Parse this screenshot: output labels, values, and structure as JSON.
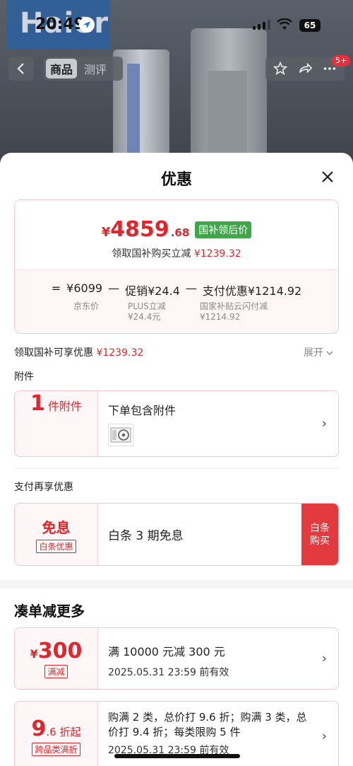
{
  "status": {
    "time": "20:49",
    "battery": "65"
  },
  "background": {
    "brand_logo": "Haier"
  },
  "nav": {
    "tabs": [
      {
        "label": "商品"
      },
      {
        "label": "测评"
      }
    ],
    "badge": "5+"
  },
  "sheet": {
    "title": "优惠",
    "price": {
      "yen": "¥",
      "integer": "4859",
      "decimal": ".68",
      "tag": "国补领后价",
      "subtitle_prefix": "领取国补购买立减",
      "subtitle_amount": "¥1239.32"
    },
    "formula": {
      "eq": "=",
      "base": "¥6099",
      "minus1": "—",
      "promo": "促销¥24.4",
      "minus2": "—",
      "pay": "支付优惠¥1214.92",
      "base_label": "京东价",
      "promo_label1": "PLUS立减",
      "promo_label2": "¥24.4元",
      "pay_label1": "国家补贴云闪付减",
      "pay_label2": "¥1214.92"
    },
    "subsidy_row": {
      "label": "领取国补可享优惠",
      "amount": "¥1239.32",
      "expand": "展开"
    },
    "accessory": {
      "section": "附件",
      "count": "1",
      "count_unit": "件附件",
      "desc": "下单包含附件"
    },
    "pay_discount": {
      "section": "支付再享优惠",
      "title": "免息",
      "tag": "白条优惠",
      "desc": "白条 3 期免息",
      "button_line1": "白条",
      "button_line2": "购买"
    },
    "more": {
      "section": "凑单减更多",
      "coupons": [
        {
          "yen": "¥",
          "value": "300",
          "suffix": "",
          "tag": "满减",
          "title": "满 10000 元减 300 元",
          "valid": "2025.05.31 23:59 前有效"
        },
        {
          "yen": "",
          "value": "9",
          "suffix": ".6 折起",
          "tag": "跨品类满折",
          "title": "购满 2 类，总价打 9.6 折；购满 3 类，总价打 9.4 折；每类限购 5 件",
          "valid": "2025.05.31 23:59 前有效"
        }
      ]
    }
  }
}
